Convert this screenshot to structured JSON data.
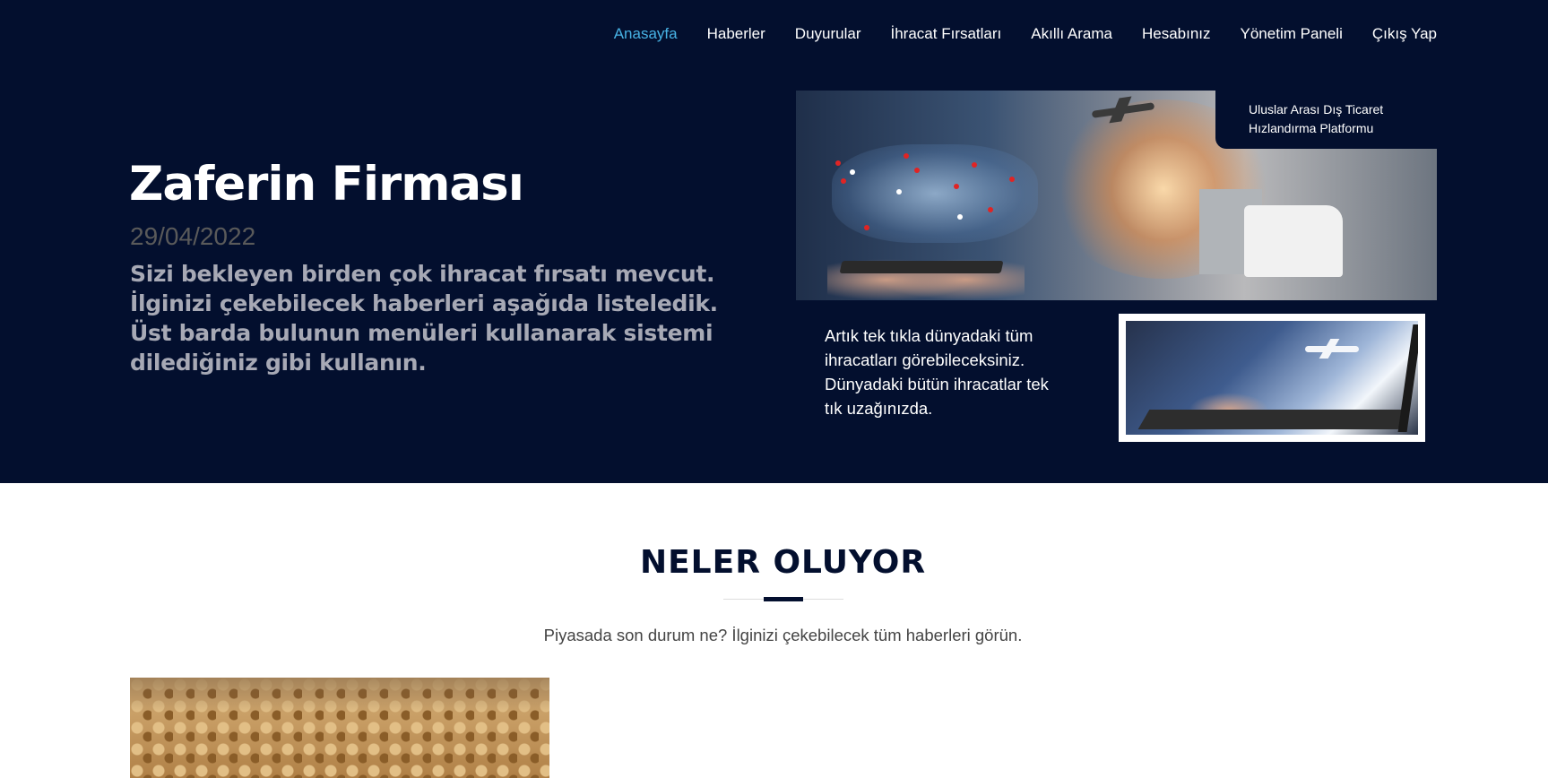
{
  "nav": {
    "items": [
      "Anasayfa",
      "Haberler",
      "Duyurular",
      "İhracat Fırsatları",
      "Akıllı Arama",
      "Hesabınız",
      "Yönetim Paneli",
      "Çıkış Yap"
    ],
    "active_index": 0
  },
  "hero": {
    "title": "Zaferin Firması",
    "date": "29/04/2022",
    "text": "Sizi bekleyen birden çok ihracat fırsatı mevcut. İlginizi çekebilecek haberleri aşağıda listeledik. Üst barda bulunun menüleri kullanarak sistemi dilediğiniz gibi kullanın."
  },
  "banner": {
    "tag_line_1": "Uluslar Arası Dış Ticaret",
    "tag_line_2": "Hızlandırma Platformu",
    "caption": "Artık tek tıkla dünyadaki tüm ihracatları görebileceksiniz. Dünyadaki bütün ihracatlar tek tık uzağınızda."
  },
  "section": {
    "title": "NELER OLUYOR",
    "subtitle": "Piyasada son durum ne? İlginizi çekebilecek tüm haberleri görün."
  },
  "colors": {
    "hero_bg": "#030f2e",
    "nav_active": "#47b2e4",
    "title_dark": "#030f2e"
  }
}
